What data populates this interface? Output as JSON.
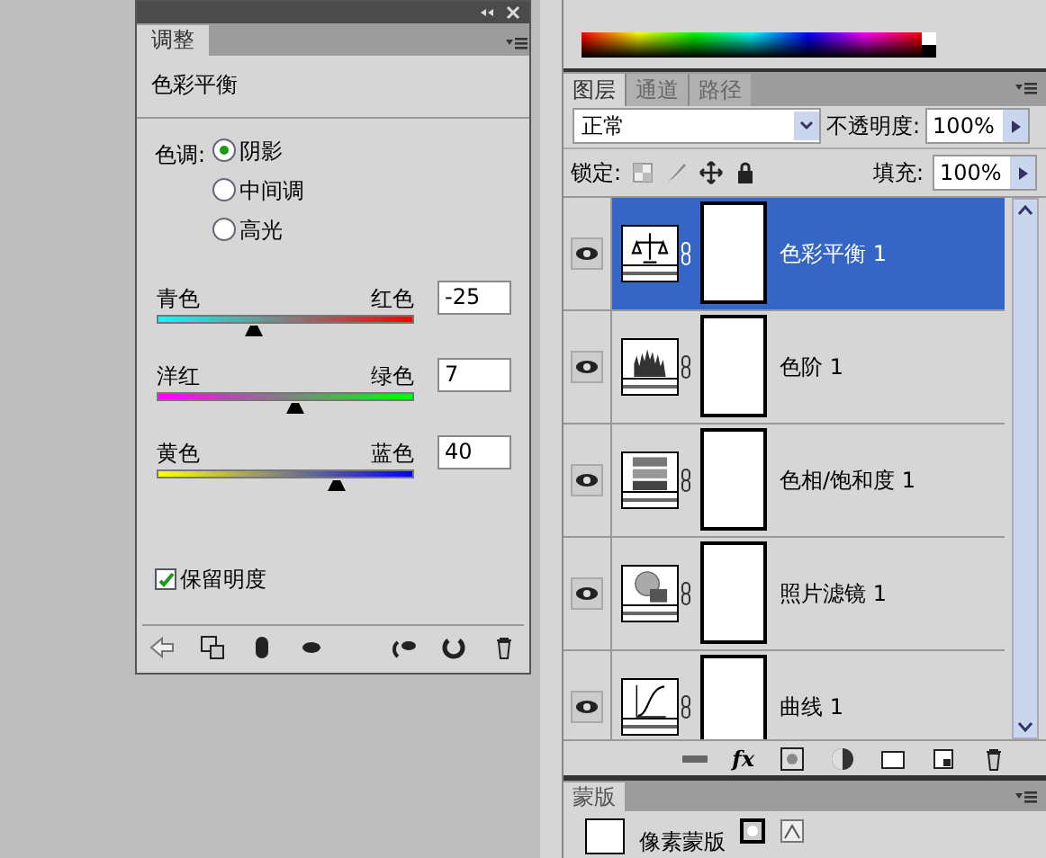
{
  "adjust_panel": {
    "tab": "调整",
    "title": "色彩平衡",
    "tone_label": "色调:",
    "tones": [
      {
        "label": "阴影",
        "selected": true
      },
      {
        "label": "中间调",
        "selected": false
      },
      {
        "label": "高光",
        "selected": false
      }
    ],
    "sliders": [
      {
        "left": "青色",
        "right": "红色",
        "value": "-25",
        "level": 0.375
      },
      {
        "left": "洋红",
        "right": "绿色",
        "value": "7",
        "level": 0.535
      },
      {
        "left": "黄色",
        "right": "蓝色",
        "value": "40",
        "level": 0.7
      }
    ],
    "preserve_luminosity": {
      "label": "保留明度",
      "checked": true
    }
  },
  "layers_panel": {
    "tabs": [
      {
        "label": "图层",
        "selected": true
      },
      {
        "label": "通道",
        "selected": false
      },
      {
        "label": "路径",
        "selected": false
      }
    ],
    "fx_label": "fx",
    "blend_mode": "正常",
    "opacity_label": "不透明度:",
    "opacity": "100%",
    "lock_label": "锁定:",
    "fill_label": "填充:",
    "fill": "100%",
    "layers": [
      {
        "name": "色彩平衡 1",
        "kind": "balance",
        "selected": true,
        "visible": true
      },
      {
        "name": "色阶 1",
        "kind": "levels",
        "selected": false,
        "visible": true
      },
      {
        "name": "色相/饱和度 1",
        "kind": "hue",
        "selected": false,
        "visible": true
      },
      {
        "name": "照片滤镜 1",
        "kind": "filter",
        "selected": false,
        "visible": true
      },
      {
        "name": "曲线 1",
        "kind": "curves",
        "selected": false,
        "visible": true
      }
    ]
  },
  "mask_panel": {
    "tab": "蒙版",
    "label": "像素蒙版"
  }
}
